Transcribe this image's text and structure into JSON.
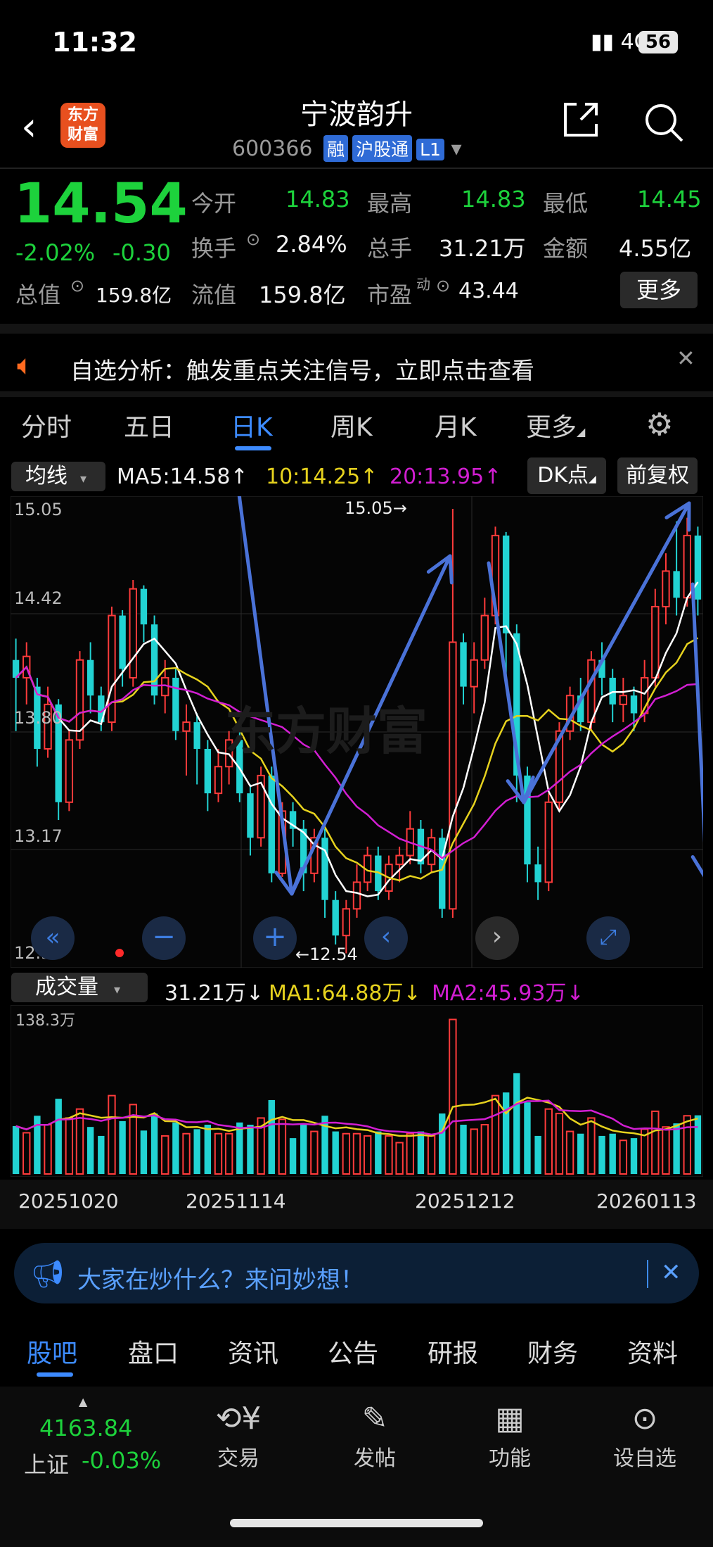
{
  "status": {
    "time": "11:32",
    "network": "4G",
    "battery": "56"
  },
  "header": {
    "name": "宁波韵升",
    "code": "600366",
    "tags": [
      "融",
      "沪股通",
      "L1"
    ],
    "logo": "东方财富"
  },
  "quote": {
    "price": "14.54",
    "change_pct": "-2.02%",
    "change": "-0.30",
    "open_label": "今开",
    "open": "14.83",
    "high_label": "最高",
    "high": "14.83",
    "low_label": "最低",
    "low": "14.45",
    "turnover_label": "换手",
    "turnover": "2.84%",
    "volume_label": "总手",
    "volume": "31.21万",
    "amount_label": "金额",
    "amount": "4.55亿",
    "mktcap_label": "总值",
    "mktcap": "159.8亿",
    "float_label": "流值",
    "float_cap": "159.8亿",
    "pe_label": "市盈",
    "pe_sup": "动",
    "pe": "43.44",
    "more": "更多"
  },
  "notice": {
    "text": "自选分析：触发重点关注信号，立即点击查看"
  },
  "tabs": [
    "分时",
    "五日",
    "日K",
    "周K",
    "月K",
    "更多"
  ],
  "active_tab": "日K",
  "kline_legend": {
    "selector": "均线",
    "ma5": "MA5:14.58↑",
    "ma10": "10:14.25↑",
    "ma20": "20:13.95↑",
    "dk": "DK点",
    "adjust": "前复权"
  },
  "price_axis": [
    "15.05",
    "14.42",
    "13.80",
    "13.17",
    "12.54"
  ],
  "high_marker": "15.05→",
  "low_marker": "←12.54",
  "watermark": "东方财富",
  "volume_legend": {
    "selector": "成交量",
    "vol": "31.21万↓",
    "ma1": "MA1:64.88万↓",
    "ma2": "MA2:45.93万↓",
    "max": "138.3万"
  },
  "date_axis": [
    "20251020",
    "20251114",
    "20251212",
    "20260113"
  ],
  "banner": {
    "text": "大家在炒什么？来问妙想！"
  },
  "subtabs": [
    "股吧",
    "盘口",
    "资讯",
    "公告",
    "研报",
    "财务",
    "资料"
  ],
  "index": {
    "value": "4163.84",
    "name": "上证",
    "change": "-0.03%"
  },
  "footer": [
    "交易",
    "发帖",
    "功能",
    "设自选"
  ],
  "colors": {
    "up": "#ff3b3b",
    "down": "#22d3d3",
    "accent": "#3d8bff",
    "ma5": "#ffffff",
    "ma10": "#e6d21e",
    "ma20": "#d21ed2"
  },
  "chart_data": {
    "type": "candlestick",
    "ylim": [
      12.54,
      15.05
    ],
    "candles": [
      [
        14.2,
        14.1,
        14.32,
        13.8
      ],
      [
        14.1,
        14.22,
        14.3,
        13.95
      ],
      [
        14.05,
        13.7,
        14.1,
        13.6
      ],
      [
        13.7,
        13.95,
        14.05,
        13.65
      ],
      [
        13.95,
        13.4,
        13.98,
        13.3
      ],
      [
        13.4,
        13.75,
        13.8,
        13.35
      ],
      [
        13.75,
        14.2,
        14.25,
        13.7
      ],
      [
        14.2,
        14.0,
        14.3,
        13.9
      ],
      [
        14.0,
        13.85,
        14.05,
        13.8
      ],
      [
        13.85,
        14.45,
        14.5,
        13.8
      ],
      [
        14.45,
        14.15,
        14.48,
        14.05
      ],
      [
        14.1,
        14.6,
        14.65,
        14.05
      ],
      [
        14.6,
        14.4,
        14.62,
        14.3
      ],
      [
        14.4,
        14.0,
        14.45,
        13.95
      ],
      [
        14.0,
        14.1,
        14.2,
        13.9
      ],
      [
        14.1,
        13.8,
        14.15,
        13.75
      ],
      [
        13.8,
        13.85,
        13.95,
        13.55
      ],
      [
        13.85,
        13.7,
        13.9,
        13.5
      ],
      [
        13.7,
        13.45,
        13.75,
        13.35
      ],
      [
        13.45,
        13.6,
        13.7,
        13.4
      ],
      [
        13.6,
        13.75,
        13.8,
        13.5
      ],
      [
        13.75,
        13.45,
        13.8,
        13.4
      ],
      [
        13.45,
        13.2,
        13.5,
        13.1
      ],
      [
        13.2,
        13.55,
        13.6,
        13.15
      ],
      [
        13.55,
        13.0,
        13.6,
        12.95
      ],
      [
        13.0,
        13.35,
        13.4,
        12.98
      ],
      [
        13.35,
        13.25,
        13.4,
        13.15
      ],
      [
        13.25,
        13.0,
        13.3,
        12.9
      ],
      [
        13.0,
        13.2,
        13.25,
        12.95
      ],
      [
        13.2,
        12.85,
        13.25,
        12.75
      ],
      [
        12.85,
        12.65,
        12.9,
        12.6
      ],
      [
        12.65,
        12.8,
        12.85,
        12.55
      ],
      [
        12.8,
        12.95,
        13.05,
        12.75
      ],
      [
        12.95,
        13.1,
        13.15,
        12.9
      ],
      [
        13.1,
        12.9,
        13.15,
        12.85
      ],
      [
        12.9,
        13.05,
        13.1,
        12.85
      ],
      [
        13.05,
        13.1,
        13.15,
        12.95
      ],
      [
        13.1,
        13.25,
        13.35,
        13.05
      ],
      [
        13.25,
        13.05,
        13.3,
        13.0
      ],
      [
        13.05,
        13.2,
        13.25,
        13.0
      ],
      [
        13.2,
        12.8,
        13.25,
        12.75
      ],
      [
        12.8,
        14.3,
        15.05,
        12.75
      ],
      [
        14.3,
        14.05,
        14.35,
        13.95
      ],
      [
        14.05,
        14.2,
        14.3,
        13.9
      ],
      [
        14.2,
        14.45,
        14.55,
        14.15
      ],
      [
        14.45,
        14.9,
        14.95,
        14.4
      ],
      [
        14.9,
        14.35,
        14.92,
        14.1
      ],
      [
        14.35,
        13.55,
        14.4,
        13.4
      ],
      [
        13.55,
        13.05,
        13.6,
        12.95
      ],
      [
        13.05,
        12.95,
        13.15,
        12.85
      ],
      [
        12.95,
        13.4,
        13.45,
        12.9
      ],
      [
        13.4,
        13.8,
        13.85,
        13.35
      ],
      [
        13.8,
        14.0,
        14.05,
        13.75
      ],
      [
        14.0,
        13.85,
        14.1,
        13.8
      ],
      [
        13.85,
        14.2,
        14.25,
        13.8
      ],
      [
        14.2,
        14.1,
        14.3,
        14.0
      ],
      [
        14.1,
        13.95,
        14.15,
        13.85
      ],
      [
        13.95,
        14.0,
        14.1,
        13.85
      ],
      [
        14.0,
        13.9,
        14.05,
        13.8
      ],
      [
        13.9,
        14.1,
        14.2,
        13.85
      ],
      [
        14.1,
        14.5,
        14.6,
        14.05
      ],
      [
        14.5,
        14.7,
        14.8,
        14.4
      ],
      [
        14.7,
        14.55,
        14.98,
        14.45
      ],
      [
        14.55,
        14.9,
        15.0,
        14.5
      ],
      [
        14.9,
        14.54,
        14.95,
        14.45
      ]
    ]
  }
}
